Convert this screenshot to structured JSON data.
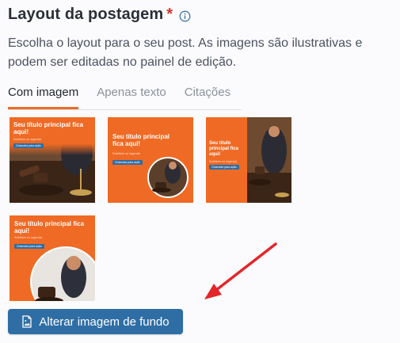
{
  "section": {
    "title": "Layout da postagem",
    "required_mark": "*",
    "info_icon": "info-circle-icon",
    "description": "Escolha o layout para o seu post. As imagens são ilustrativas e podem ser editadas no painel de edição."
  },
  "tabs": [
    {
      "label": "Com imagem",
      "active": true
    },
    {
      "label": "Apenas texto",
      "active": false
    },
    {
      "label": "Citações",
      "active": false
    }
  ],
  "templates": [
    {
      "title": "Seu título principal fica aqui!",
      "subtitle": "Subtítulo ou legenda",
      "button": "Chamada para ação"
    },
    {
      "title": "Seu título principal fica aqui!",
      "subtitle": "Subtítulo ou legenda",
      "button": "Chamada para ação"
    },
    {
      "title": "Seu título principal fica aqui!",
      "subtitle": "Subtítulo ou legenda",
      "button": "Chamada para ação"
    },
    {
      "title": "Seu título principal fica aqui!",
      "subtitle": "Subtítulo ou legenda",
      "button": "Chamada para ação"
    }
  ],
  "action_button": {
    "label": "Alterar imagem de fundo",
    "icon": "file-image-icon"
  },
  "colors": {
    "accent_orange": "#ef6a24",
    "primary_blue": "#2f6ea5",
    "required_red": "#e0312b",
    "arrow_red": "#e3262b"
  }
}
